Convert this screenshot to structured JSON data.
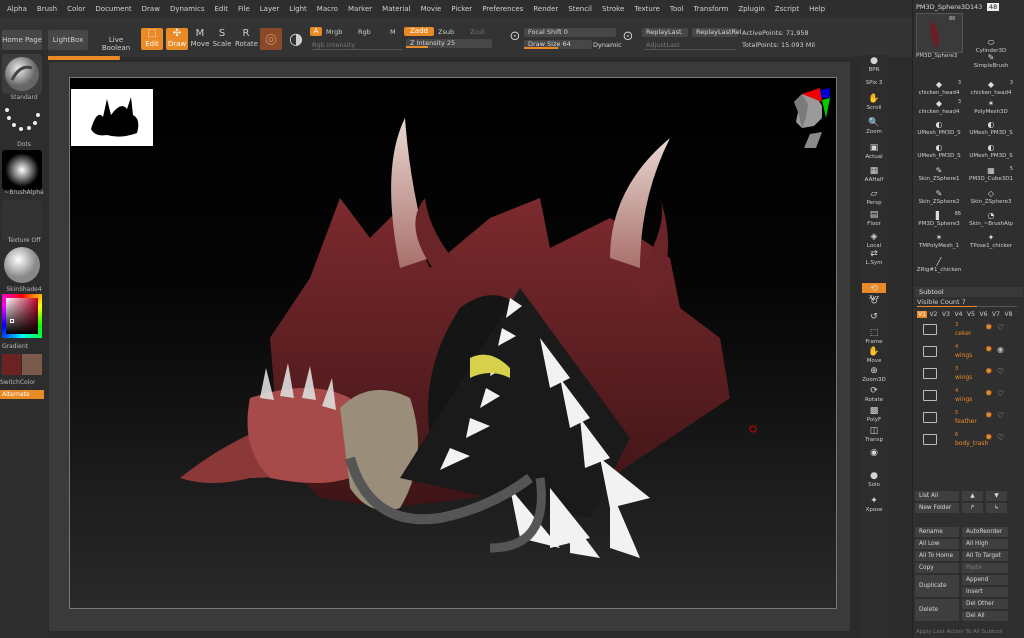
{
  "menu": [
    "Alpha",
    "Brush",
    "Color",
    "Document",
    "Draw",
    "Dynamics",
    "Edit",
    "File",
    "Layer",
    "Light",
    "Macro",
    "Marker",
    "Material",
    "Movie",
    "Picker",
    "Preferences",
    "Render",
    "Stencil",
    "Stroke",
    "Texture",
    "Tool",
    "Transform",
    "Zplugin",
    "Zscript",
    "Help"
  ],
  "toolbar": {
    "home_page": "Home Page",
    "lightbox": "LightBox",
    "live_boolean": "Live Boolean",
    "edit": "Edit",
    "draw": "Draw",
    "move": "Move",
    "scale": "Scale",
    "rotate": "Rotate",
    "a_btn": "A",
    "mrgb": "Mrgb",
    "rgb": "Rgb",
    "m": "M",
    "rgb_intensity": "Rgb Intensity",
    "zadd": "Zadd",
    "zsub": "Zsub",
    "zcut": "Zcut",
    "z_intensity": "Z Intensity 25",
    "focal_shift": "Focal Shift 0",
    "draw_size": "Draw Size 64",
    "dynamic": "Dynamic",
    "replay_last": "ReplayLast",
    "replay_last_rel": "ReplayLastRel",
    "adjust_last": "AdjustLast",
    "active_points": "ActivePoints: 71,958",
    "total_points": "TotalPoints: 15.093 Mil",
    "z_intensity_level": 0.25,
    "draw_size_level": 0.5
  },
  "left_shelf": {
    "brush": "Standard",
    "stroke": "Dots",
    "alpha": "~BrushAlpha",
    "texture": "Texture Off",
    "material": "SkinShade4",
    "gradient": "Gradient",
    "switch_color": "SwitchColor",
    "alternate": "Alternate"
  },
  "right_toolbar": [
    "BPR",
    "SPix 3",
    "Scroll",
    "Zoom",
    "Actual",
    "AAHalf",
    "Persp",
    "Floor",
    "Local",
    "L.Sym",
    "Xyz",
    "",
    "",
    "Frame",
    "Move",
    "Zoom3D",
    "Rotate",
    "PolyF",
    "Transp",
    "",
    "Solo",
    "Xpose"
  ],
  "right_toolbar_icons": [
    "sphere-icon",
    "",
    "scroll-icon",
    "zoom-icon",
    "actual-icon",
    "aahalf-icon",
    "persp-icon",
    "floor-icon",
    "local-icon",
    "lsym-icon",
    "xyz-icon",
    "rot-a-icon",
    "rot-b-icon",
    "frame-icon",
    "move-icon",
    "zoom3d-icon",
    "rotate-icon",
    "polyf-icon",
    "transp-icon",
    "ghost-icon",
    "solo-icon",
    "xpose-icon"
  ],
  "tool_panel": {
    "current_tool": "PM3D_Sphere3D1",
    "count_a": "43",
    "count_b": "48",
    "items": [
      {
        "label": "PM3D_Sphere3",
        "badge": "86"
      },
      {
        "label": "Cylinder3D",
        "badge": ""
      },
      {
        "label": "SimpleBrush",
        "badge": ""
      },
      {
        "label": "chicken_head4",
        "badge": "3"
      },
      {
        "label": "chicken_head4",
        "badge": "3"
      },
      {
        "label": "chicken_head4",
        "badge": "3"
      },
      {
        "label": "PolyMesh3D",
        "badge": ""
      },
      {
        "label": "UMesh_PM3D_S",
        "badge": ""
      },
      {
        "label": "UMesh_PM3D_S",
        "badge": ""
      },
      {
        "label": "UMesh_PM3D_S",
        "badge": ""
      },
      {
        "label": "UMesh_PM3D_S",
        "badge": ""
      },
      {
        "label": "Skin_ZSphere1",
        "badge": ""
      },
      {
        "label": "PM3D_Cube3D1",
        "badge": "5"
      },
      {
        "label": "Skin_ZSphere2",
        "badge": ""
      },
      {
        "label": "Skin_ZSphere3",
        "badge": ""
      },
      {
        "label": "PM3D_Sphere3",
        "badge": "86"
      },
      {
        "label": "Skin_~BrushAlp",
        "badge": ""
      },
      {
        "label": "TMPolyMesh_1",
        "badge": ""
      },
      {
        "label": "TPose1_chicker",
        "badge": ""
      },
      {
        "label": "ZRig#1_chicken",
        "badge": ""
      }
    ]
  },
  "subtool": {
    "title": "Subtool",
    "visible_count": "Visible Count 7",
    "versions": [
      "V1",
      "V2",
      "V3",
      "V4",
      "V5",
      "V6",
      "V7",
      "V8"
    ],
    "rows": [
      {
        "n": "3",
        "name": "ceker"
      },
      {
        "n": "4",
        "name": "wings"
      },
      {
        "n": "3",
        "name": "wings"
      },
      {
        "n": "4",
        "name": "wings"
      },
      {
        "n": "5",
        "name": "feather"
      },
      {
        "n": "6",
        "name": "body_trash"
      }
    ],
    "list_all": "List All",
    "new_folder": "New Folder",
    "rename": "Rename",
    "auto_reorder": "AutoReorder",
    "all_low": "All Low",
    "all_high": "All High",
    "all_to_home": "All To Home",
    "all_to_target": "All To Target",
    "copy": "Copy",
    "paste": "Paste",
    "duplicate": "Duplicate",
    "append": "Append",
    "insert": "Insert",
    "delete": "Delete",
    "del_other": "Del Other",
    "del_all": "Del All",
    "apply_last": "Apply Last Action To All Subtool"
  },
  "colors": {
    "accent": "#e98a26",
    "background": "#2b2b2b",
    "panel": "#2f2f2f"
  }
}
